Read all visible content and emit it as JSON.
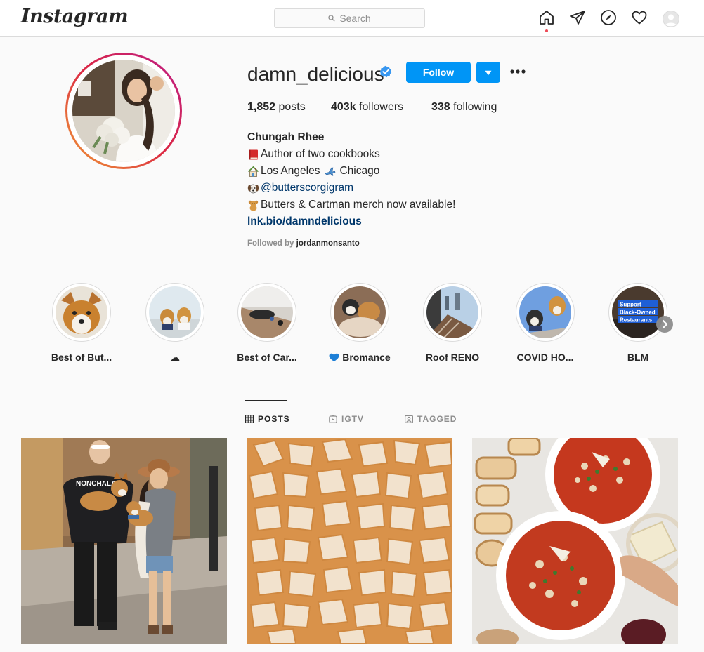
{
  "nav": {
    "logo": "Instagram",
    "search_placeholder": "Search",
    "icons": [
      "home-icon",
      "direct-icon",
      "explore-icon",
      "activity-heart-icon",
      "profile-avatar"
    ]
  },
  "profile": {
    "username": "damn_delicious",
    "verified": true,
    "follow_label": "Follow",
    "stats": {
      "posts_count": "1,852",
      "posts_label": "posts",
      "followers_count": "403k",
      "followers_label": "followers",
      "following_count": "338",
      "following_label": "following"
    },
    "bio": {
      "name": "Chungah Rhee",
      "line1": "Author of two cookbooks",
      "line2_a": "Los Angeles",
      "line2_b": "Chicago",
      "line3": "@butterscorgigram",
      "line4": "Butters & Cartman merch now available!",
      "link": "lnk.bio/damndelicious"
    },
    "followed_by_prefix": "Followed by",
    "followed_by_user": "jordanmonsanto"
  },
  "highlights": [
    {
      "label": "Best of But..."
    },
    {
      "label": "☁"
    },
    {
      "label": "Best of Car..."
    },
    {
      "label": "Bromance",
      "emoji": "blue-heart"
    },
    {
      "label": "Roof RENO"
    },
    {
      "label": "COVID HO..."
    },
    {
      "label": "BLM",
      "overlay_text": "Support Black-Owned Restaurants"
    }
  ],
  "tabs": [
    {
      "label": "POSTS",
      "icon": "grid-icon",
      "active": true
    },
    {
      "label": "IGTV",
      "icon": "igtv-icon",
      "active": false
    },
    {
      "label": "TAGGED",
      "icon": "tagged-icon",
      "active": false
    }
  ],
  "posts": [
    {
      "subject": "couple-walking-with-corgis",
      "shirt_text": "NONCHALA"
    },
    {
      "subject": "powdered-pasta-pillows"
    },
    {
      "subject": "minestrone-soup-bowls"
    }
  ],
  "colors": {
    "accent": "#0095f6",
    "link": "#00376b",
    "border": "#dbdbdb",
    "muted": "#8e8e8e",
    "notification": "#ed4956"
  }
}
